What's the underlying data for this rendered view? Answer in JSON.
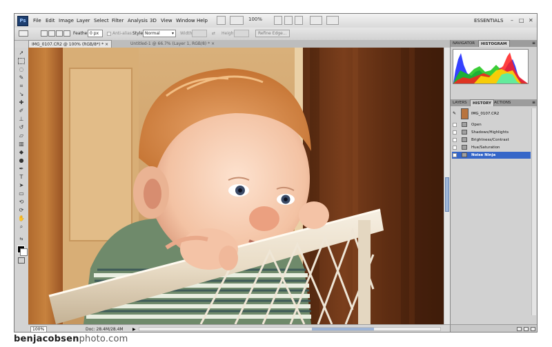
{
  "menu": {
    "app_logo": "Ps",
    "items": [
      "File",
      "Edit",
      "Image",
      "Layer",
      "Select",
      "Filter",
      "Analysis",
      "3D",
      "View",
      "Window",
      "Help"
    ],
    "zoom_value": "100%",
    "workspace": "ESSENTIALS"
  },
  "options_bar": {
    "feather_label": "Feather:",
    "feather_value": "0 px",
    "antialias_label": "Anti-alias",
    "style_label": "Style:",
    "style_value": "Normal",
    "width_label": "Width:",
    "height_label": "Height:",
    "refine_edge_label": "Refine Edge..."
  },
  "documents": {
    "tabs": [
      {
        "label": "IMG_0107.CR2 @ 100% (RGB/8*) *",
        "active": true
      },
      {
        "label": "Untitled-1 @ 66.7% (Layer 1, RGB/8) *",
        "active": false
      }
    ]
  },
  "status": {
    "zoom": "100%",
    "doc_size": "Doc: 28.4M/28.4M"
  },
  "panels": {
    "top_tabs": [
      "NAVIGATOR",
      "HISTOGRAM"
    ],
    "bottom_tabs": [
      "LAYERS",
      "HISTORY",
      "ACTIONS"
    ],
    "snapshot_name": "IMG_0107.CR2",
    "history_steps": [
      {
        "label": "Open",
        "selected": false
      },
      {
        "label": "Shadows/Highlights",
        "selected": false
      },
      {
        "label": "Brightness/Contrast",
        "selected": false
      },
      {
        "label": "Hue/Saturation",
        "selected": false
      },
      {
        "label": "Noise Ninja",
        "selected": true
      }
    ]
  },
  "watermark": {
    "brand": "benjacobsen",
    "domain": "photo.com"
  },
  "colors": {
    "selection": "#3566c8",
    "menu_bg": "#e4e4e4",
    "panel_bg": "#d1d1d1"
  }
}
